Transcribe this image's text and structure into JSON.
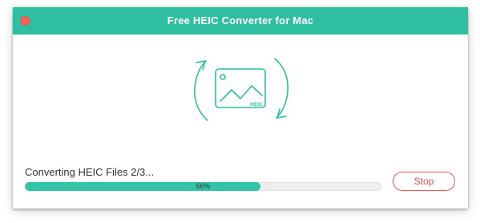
{
  "window": {
    "title": "Free HEIC Converter for Mac"
  },
  "icon": {
    "name": "heic-convert-icon",
    "badge_text": "HEIC",
    "accent_color": "#2dbf9f"
  },
  "status": {
    "label": "Converting HEIC Files 2/3..."
  },
  "progress": {
    "percent": 66,
    "text": "66%"
  },
  "actions": {
    "stop_label": "Stop"
  },
  "colors": {
    "titlebar": "#2dbf9f",
    "progress_fill": "#35c3a5",
    "stop_button": "#e9585a",
    "close_button": "#fc5f57"
  }
}
